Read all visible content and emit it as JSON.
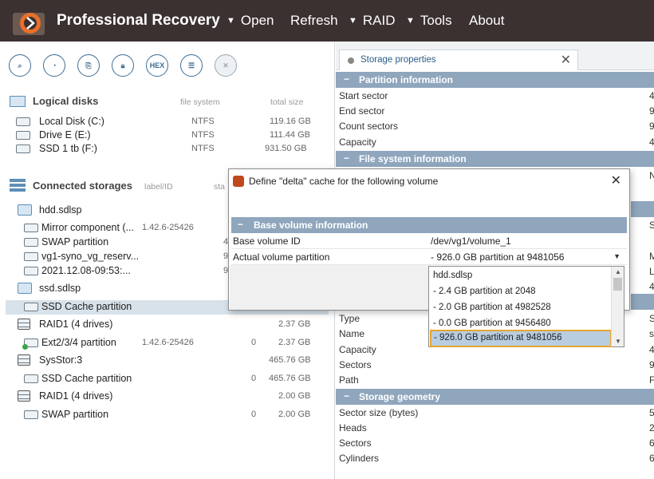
{
  "app": {
    "title": "Professional Recovery"
  },
  "menu": [
    {
      "label": "Open",
      "arrow": true
    },
    {
      "label": "Refresh",
      "arrow": false
    },
    {
      "label": "RAID",
      "arrow": true
    },
    {
      "label": "Tools",
      "arrow": true
    },
    {
      "label": "About",
      "arrow": false
    }
  ],
  "toolbar": {
    "hex_label": "HEX"
  },
  "logical": {
    "title": "Logical disks",
    "col_fs": "file system",
    "col_size": "total size",
    "items": [
      {
        "name": "Local Disk (C:)",
        "fs": "NTFS",
        "size": "119.16 GB"
      },
      {
        "name": "Drive E (E:)",
        "fs": "NTFS",
        "size": "111.44 GB"
      },
      {
        "name": "SSD 1 tb (F:)",
        "fs": "NTFS",
        "size": "931.50 GB"
      }
    ]
  },
  "storages": {
    "title": "Connected storages",
    "col_label": "label/ID",
    "col_start": "sta",
    "items": [
      {
        "name": "hdd.sdlsp"
      },
      {
        "name": "Mirror component (...",
        "label": "1.42.6-25426"
      },
      {
        "name": "SWAP partition",
        "start": "4"
      },
      {
        "name": "vg1-syno_vg_reserv...",
        "start": "9"
      },
      {
        "name": "2021.12.08-09:53:...",
        "start": "9"
      },
      {
        "name": "ssd.sdlsp"
      },
      {
        "name": "SSD Cache partition"
      },
      {
        "name": "RAID1 (4 drives)",
        "size": "2.37 GB"
      },
      {
        "name": "Ext2/3/4 partition",
        "label": "1.42.6-25426",
        "start": "0",
        "size": "2.37 GB"
      },
      {
        "name": "SysStor:3",
        "size": "465.76 GB"
      },
      {
        "name": "SSD Cache partition",
        "start": "0",
        "size": "465.76 GB"
      },
      {
        "name": "RAID1 (4 drives)",
        "size": "2.00 GB"
      },
      {
        "name": "SWAP partition",
        "start": "0",
        "size": "2.00 GB"
      }
    ]
  },
  "panel": {
    "tab": "Storage properties",
    "partition_info": {
      "title": "Partition information",
      "rows": [
        {
          "k": "Start sector",
          "v": "4"
        },
        {
          "k": "End sector",
          "v": "9"
        },
        {
          "k": "Count sectors",
          "v": "9"
        },
        {
          "k": "Capacity",
          "v": "4"
        }
      ]
    },
    "fs_info": {
      "title": "File system information",
      "v1": "N"
    },
    "hidden_vals": [
      "S",
      "M",
      "L",
      "4"
    ],
    "dev_rows": [
      {
        "k": "Type",
        "v": "S"
      },
      {
        "k": "Name",
        "v": "s"
      },
      {
        "k": "Capacity",
        "v": "4"
      },
      {
        "k": "Sectors",
        "v": "9"
      },
      {
        "k": "Path",
        "v": "F"
      }
    ],
    "geometry": {
      "title": "Storage geometry",
      "rows": [
        {
          "k": "Sector size (bytes)",
          "v": "5"
        },
        {
          "k": "Heads",
          "v": "2"
        },
        {
          "k": "Sectors",
          "v": "6"
        },
        {
          "k": "Cylinders",
          "v": "6"
        }
      ]
    }
  },
  "dialog": {
    "title": "Define \"delta\" cache for the following volume",
    "group": "Base volume information",
    "base_id_label": "Base volume ID",
    "base_id_value": "/dev/vg1/volume_1",
    "partition_label": "Actual volume partition",
    "partition_value": "- 926.0 GB partition at 9481056",
    "options": [
      "hdd.sdlsp",
      "- 2.4 GB partition at 2048",
      "- 2.0 GB partition at 4982528",
      "- 0.0 GB partition at 9456480",
      "- 926.0 GB partition at 9481056"
    ]
  }
}
